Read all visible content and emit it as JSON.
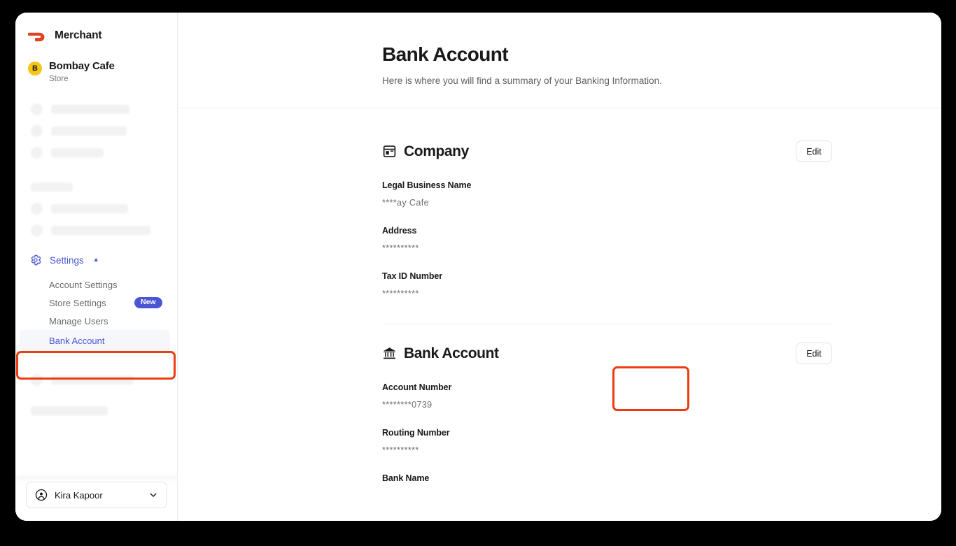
{
  "brand": {
    "name": "Merchant",
    "logo_color": "#e2401e"
  },
  "store": {
    "initial": "B",
    "name": "Bombay Cafe",
    "type": "Store",
    "avatar_color": "#f5c518"
  },
  "sidebar": {
    "settings": {
      "label": "Settings",
      "chevron": "chevron-up-icon",
      "accent": "#4a56d2"
    },
    "sub_items": [
      {
        "label": "Account Settings",
        "badge": "",
        "active": false
      },
      {
        "label": "Store Settings",
        "badge": "New",
        "active": false
      },
      {
        "label": "Manage Users",
        "badge": "",
        "active": false
      },
      {
        "label": "Bank Account",
        "badge": "",
        "active": true
      }
    ]
  },
  "user": {
    "name": "Kira Kapoor",
    "avatar": "account-circle-icon",
    "chevron": "chevron-down-icon"
  },
  "page": {
    "title": "Bank Account",
    "subtitle": "Here is where you will find a summary of your Banking Information."
  },
  "sections": [
    {
      "id": "company",
      "icon": "storefront-icon",
      "title": "Company",
      "edit_label": "Edit",
      "fields": [
        {
          "label": "Legal Business Name",
          "value": "****ay Cafe"
        },
        {
          "label": "Address",
          "value": "**********"
        },
        {
          "label": "Tax ID Number",
          "value": "**********"
        }
      ]
    },
    {
      "id": "bank-account",
      "icon": "bank-icon",
      "title": "Bank Account",
      "edit_label": "Edit",
      "fields": [
        {
          "label": "Account Number",
          "value": "********0739"
        },
        {
          "label": "Routing Number",
          "value": "**********"
        },
        {
          "label": "Bank Name",
          "value": ""
        }
      ]
    }
  ],
  "annotations": {
    "color": "#ee3c11",
    "targets": [
      "sidebar-item-bank-account",
      "bank-account-edit-button"
    ]
  }
}
